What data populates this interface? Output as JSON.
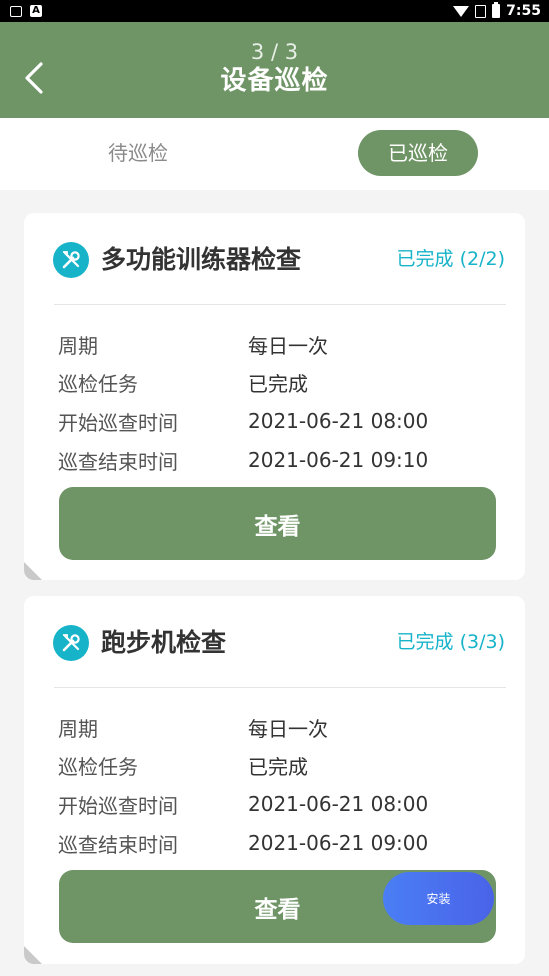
{
  "status_bar": {
    "time": "7:55"
  },
  "header": {
    "counter": "3 / 3",
    "title": "设备巡检"
  },
  "tabs": [
    {
      "label": "待巡检",
      "active": false
    },
    {
      "label": "已巡检",
      "active": true
    }
  ],
  "cards": [
    {
      "title": "多功能训练器检查",
      "status": "已完成 (2/2)",
      "rows": [
        {
          "label": "周期",
          "value": "每日一次"
        },
        {
          "label": "巡检任务",
          "value": "已完成"
        },
        {
          "label": "开始巡查时间",
          "value": "2021-06-21 08:00"
        },
        {
          "label": "巡查结束时间",
          "value": "2021-06-21 09:10"
        }
      ],
      "button": "查看"
    },
    {
      "title": "跑步机检查",
      "status": "已完成 (3/3)",
      "rows": [
        {
          "label": "周期",
          "value": "每日一次"
        },
        {
          "label": "巡检任务",
          "value": "已完成"
        },
        {
          "label": "开始巡查时间",
          "value": "2021-06-21 08:00"
        },
        {
          "label": "巡查结束时间",
          "value": "2021-06-21 09:00"
        }
      ],
      "button": "查看"
    }
  ],
  "install_button": "安装",
  "colors": {
    "header_green": "#6f9566",
    "accent_teal": "#17b3c9",
    "install_blue": "#4a7ef5"
  }
}
